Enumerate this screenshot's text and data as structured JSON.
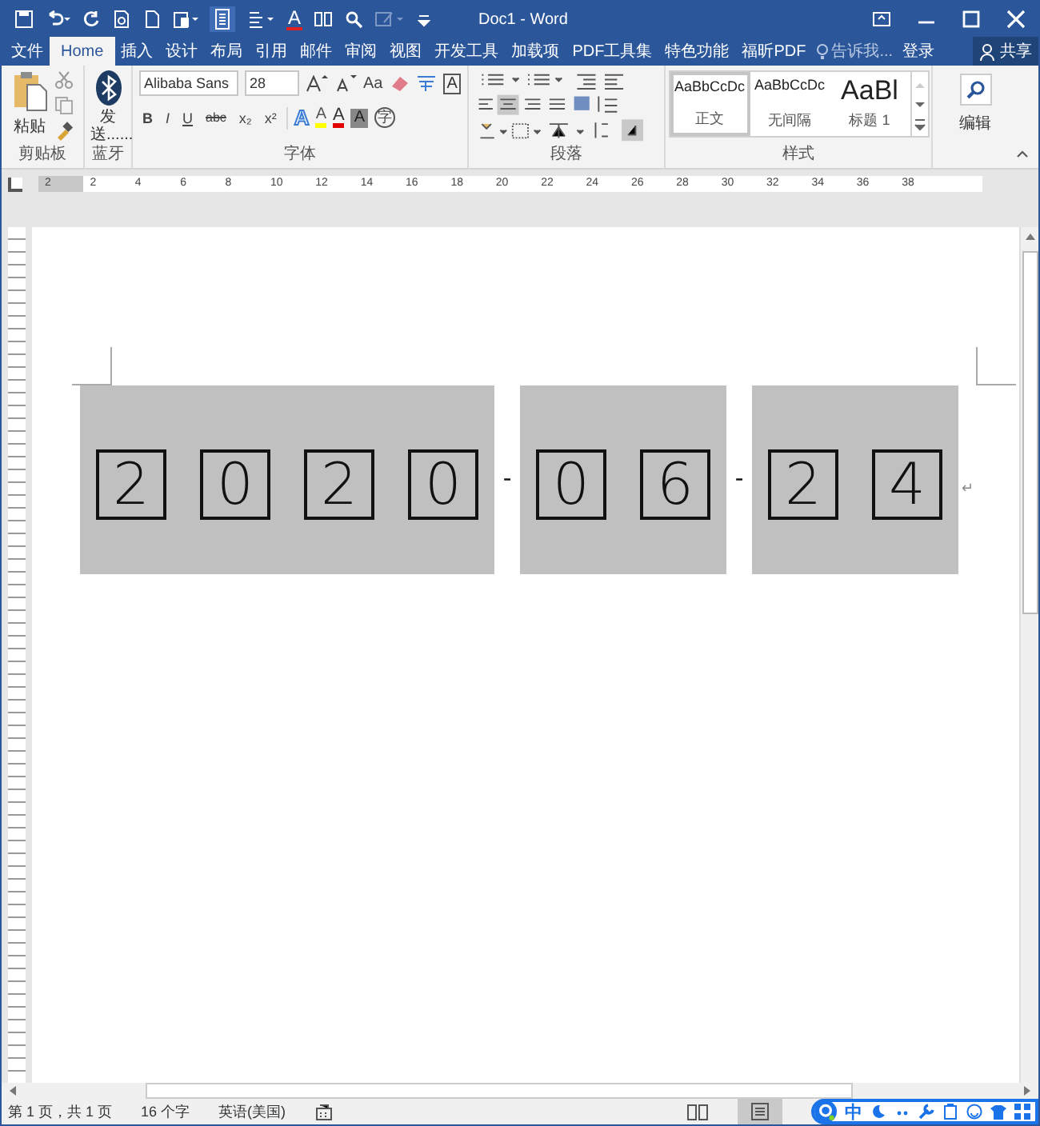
{
  "title_bar": {
    "title": "Doc1 - Word",
    "font_color_glyph": "A"
  },
  "tabs": [
    {
      "label": "文件",
      "selected": false
    },
    {
      "label": "Home",
      "selected": true
    },
    {
      "label": "插入",
      "selected": false
    },
    {
      "label": "设计",
      "selected": false
    },
    {
      "label": "布局",
      "selected": false
    },
    {
      "label": "引用",
      "selected": false
    },
    {
      "label": "邮件",
      "selected": false
    },
    {
      "label": "审阅",
      "selected": false
    },
    {
      "label": "视图",
      "selected": false
    },
    {
      "label": "开发工具",
      "selected": false
    },
    {
      "label": "加载项",
      "selected": false
    },
    {
      "label": "PDF工具集",
      "selected": false
    },
    {
      "label": "特色功能",
      "selected": false
    },
    {
      "label": "福昕PDF",
      "selected": false
    }
  ],
  "tell_me": "告诉我...",
  "sign_in": "登录",
  "share": "共享",
  "ribbon": {
    "clipboard": {
      "paste": "粘贴",
      "label": "剪贴板"
    },
    "bluetooth": {
      "send": "发送......",
      "label": "蓝牙"
    },
    "font": {
      "name": "Alibaba Sans",
      "size": "28",
      "change_case": "Aa",
      "format_buttons": [
        "B",
        "I",
        "U",
        "abc",
        "x₂",
        "x²"
      ],
      "border_glyph": "A",
      "effects_glyph": "A",
      "highlight_glyph": "A",
      "color_glyph": "A",
      "shade_glyph": "A",
      "enclose_glyph": "字",
      "label": "字体"
    },
    "paragraph": {
      "label": "段落"
    },
    "styles": {
      "items": [
        {
          "preview": "AaBbCcDc",
          "name": "正文",
          "selected": true
        },
        {
          "preview": "AaBbCcDc",
          "name": "无间隔",
          "selected": false
        },
        {
          "preview": "AaBl",
          "name": "标题 1",
          "selected": false
        }
      ],
      "label": "样式"
    },
    "editing": {
      "label": "编辑"
    }
  },
  "ruler": {
    "labels": [
      "2",
      "2",
      "4",
      "6",
      "8",
      "10",
      "12",
      "14",
      "16",
      "18",
      "20",
      "22",
      "24",
      "26",
      "28",
      "30",
      "32",
      "34",
      "36",
      "38"
    ]
  },
  "document": {
    "date_groups": [
      {
        "digits": [
          "2",
          "0",
          "2",
          "0"
        ]
      },
      {
        "digits": [
          "0",
          "6"
        ]
      },
      {
        "digits": [
          "2",
          "4"
        ]
      }
    ],
    "separator": "-",
    "paragraph_mark": "↵"
  },
  "status_bar": {
    "page": "第 1 页，共 1 页",
    "words": "16 个字",
    "language": "英语(美国)"
  },
  "ime_toolbar": {
    "mode": "中"
  }
}
